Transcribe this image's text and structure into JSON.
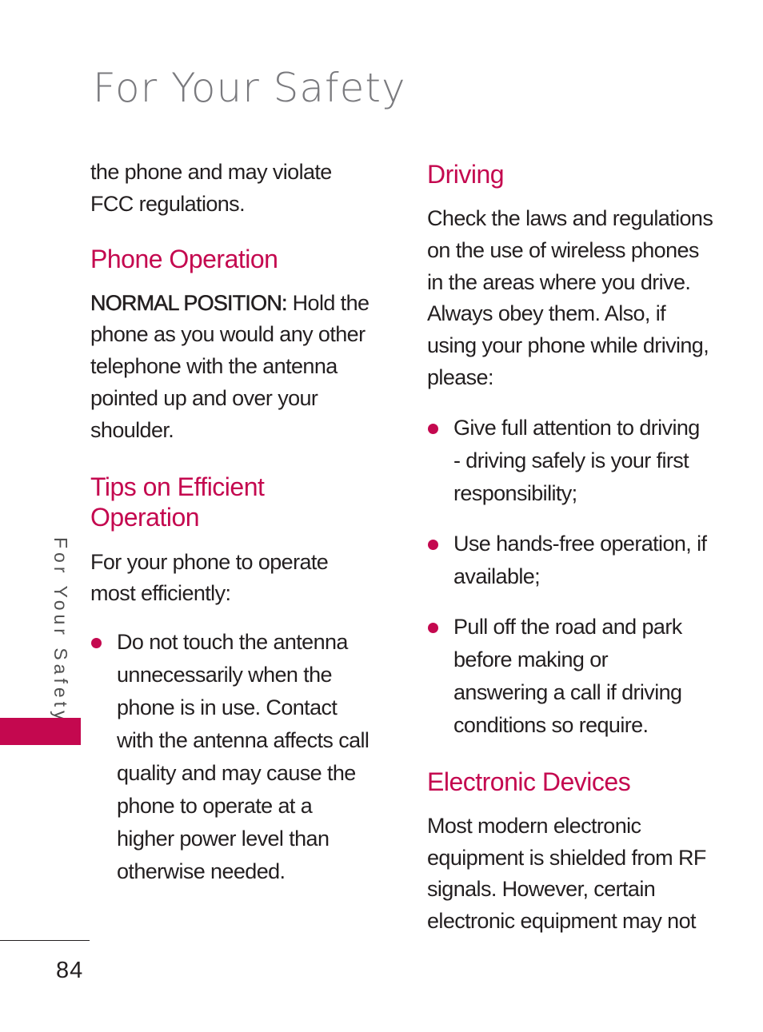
{
  "page": {
    "title": "For Your Safety",
    "side_label": "For Your Safety",
    "page_number": "84",
    "accent_color": "#c4084f"
  },
  "left_column": {
    "continuation": [
      "the phone and may violate",
      "FCC regulations."
    ],
    "phone_operation": {
      "heading": "Phone Operation",
      "lead_bold": "NORMAL POSITION:",
      "lead_text": " Hold the phone as you would any other telephone with the antenna pointed up and over your shoulder."
    },
    "tips": {
      "heading_line1": "Tips on Efficient",
      "heading_line2": "Operation",
      "intro": "For your phone to operate most efficiently:",
      "bullets": [
        "Do not touch the antenna unnecessarily when the phone is in use. Contact with the antenna affects call quality and may cause the phone to operate at a higher power level than otherwise needed."
      ]
    }
  },
  "right_column": {
    "driving": {
      "heading": "Driving",
      "intro": "Check the laws and regulations on the use of wireless phones in the areas where you drive. Always obey them. Also, if using your phone while driving, please:",
      "bullets": [
        "Give full attention to driving - driving safely is your first responsibility;",
        "Use hands-free operation, if available;",
        "Pull off the road and park before making or answering a call if driving conditions so require."
      ]
    },
    "electronic_devices": {
      "heading": "Electronic Devices",
      "body": "Most modern electronic equipment is shielded from RF signals. However, certain electronic equipment may not"
    }
  }
}
